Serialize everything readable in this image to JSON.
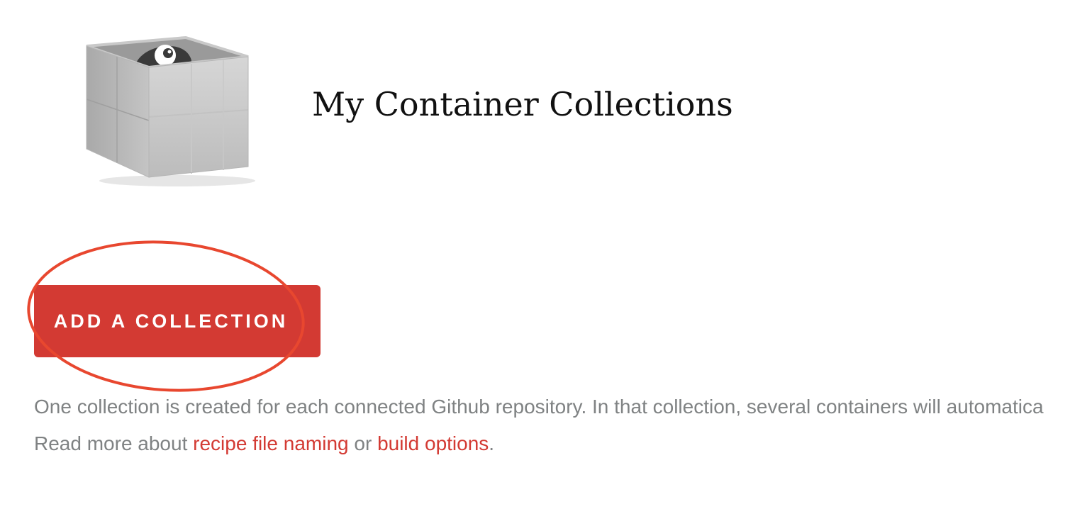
{
  "header": {
    "title": "My Container Collections",
    "logo_icon": "container-box-logo-icon"
  },
  "actions": {
    "add_collection_label": "ADD A COLLECTION",
    "annotation": "red-ellipse-highlight"
  },
  "info": {
    "description": "One collection is created for each connected Github repository. In that collection, several containers will automatica",
    "read_more_prefix": "Read more about ",
    "link_recipe": "recipe file naming",
    "connector": " or ",
    "link_build": "build options",
    "suffix": "."
  },
  "colors": {
    "accent": "#d33a33",
    "muted_text": "#7f8283",
    "title_text": "#111111",
    "annotation": "#e8472f"
  }
}
